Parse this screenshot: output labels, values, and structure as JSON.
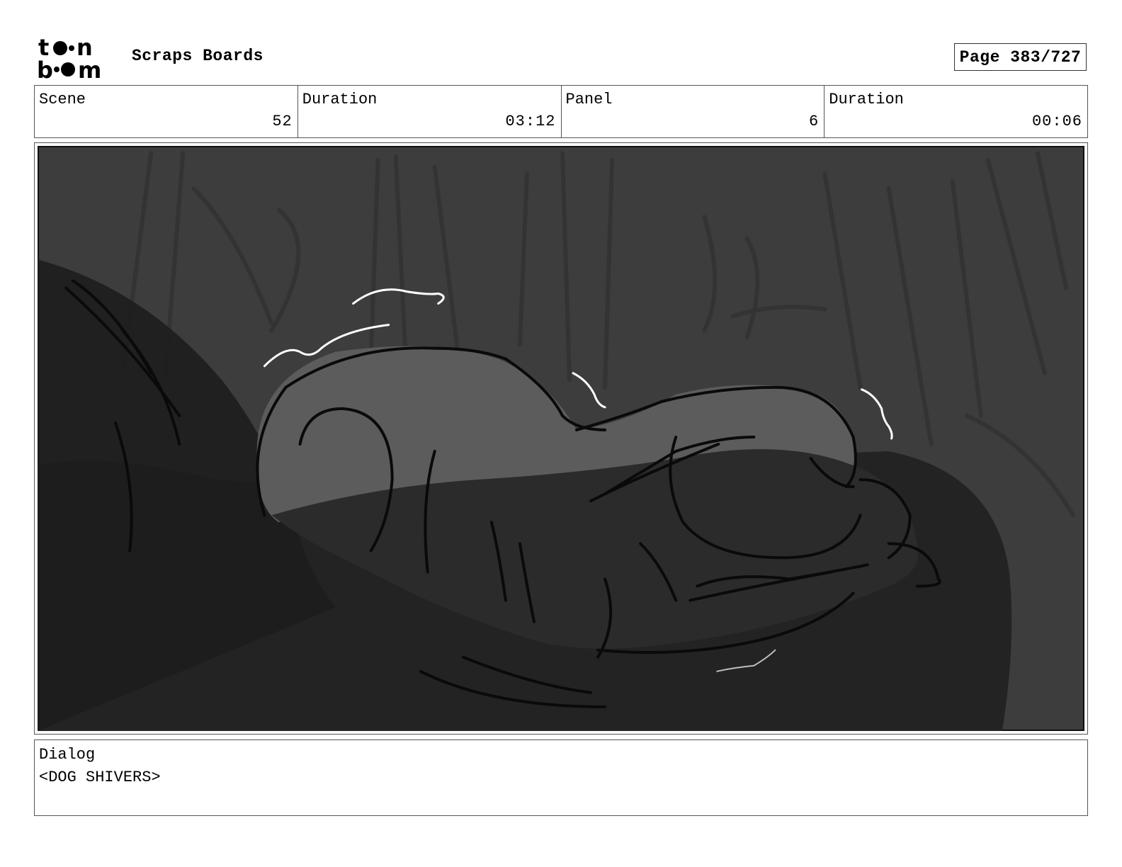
{
  "header": {
    "logo": "toon boom",
    "project_title": "Scraps Boards",
    "page_label": "Page 383/727"
  },
  "info": {
    "scene_label": "Scene",
    "scene_value": "52",
    "scene_duration_label": "Duration",
    "scene_duration_value": "03:12",
    "panel_label": "Panel",
    "panel_value": "6",
    "panel_duration_label": "Duration",
    "panel_duration_value": "00:06"
  },
  "dialog": {
    "label": "Dialog",
    "text": "<DOG SHIVERS>"
  },
  "colors": {
    "panel_background": "#3c3c3c",
    "panel_foreground_dark": "#1f1f1f",
    "dog_fill": "#5a5a5a",
    "line": "#0a0a0a",
    "shiver_lines": "#ffffff"
  }
}
